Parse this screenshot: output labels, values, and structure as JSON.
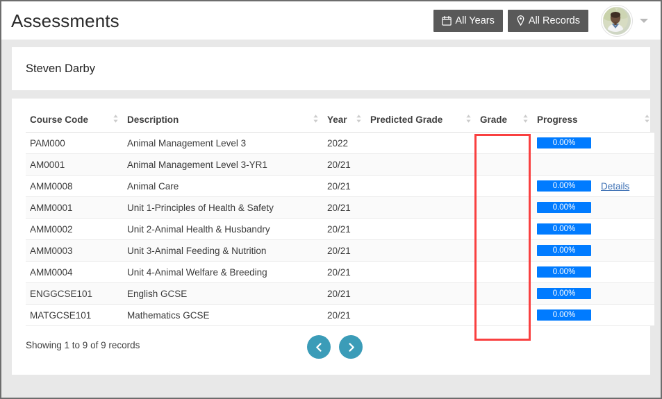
{
  "header": {
    "title": "Assessments",
    "buttons": [
      {
        "label": "All Years",
        "icon": "calendar-icon"
      },
      {
        "label": "All Records",
        "icon": "pin-icon"
      }
    ],
    "avatar_icon": "user-avatar",
    "caret_icon": "chevron-down-icon"
  },
  "student": {
    "name": "Steven Darby"
  },
  "table": {
    "columns": [
      {
        "key": "code",
        "label": "Course Code",
        "sortable": true
      },
      {
        "key": "desc",
        "label": "Description",
        "sortable": true
      },
      {
        "key": "year",
        "label": "Year",
        "sortable": true
      },
      {
        "key": "pred",
        "label": "Predicted Grade",
        "sortable": true
      },
      {
        "key": "grade",
        "label": "Grade",
        "sortable": true
      },
      {
        "key": "progress",
        "label": "Progress",
        "sortable": true
      }
    ],
    "sort_icon": "sort-updown-icon",
    "rows": [
      {
        "code": "PAM000",
        "indent": 0,
        "desc": "Animal Management Level 3",
        "year": "2022",
        "pred": "",
        "grade": "",
        "progress": "0.00%",
        "has_progress": true,
        "details": ""
      },
      {
        "code": "AM0001",
        "indent": 1,
        "desc": "Animal Management Level 3-YR1",
        "year": "20/21",
        "pred": "",
        "grade": "",
        "progress": "",
        "has_progress": false,
        "details": ""
      },
      {
        "code": "AMM0008",
        "indent": 2,
        "desc": "Animal Care",
        "year": "20/21",
        "pred": "",
        "grade": "",
        "progress": "0.00%",
        "has_progress": true,
        "details": "Details"
      },
      {
        "code": "AMM0001",
        "indent": 2,
        "desc": "Unit 1-Principles of Health & Safety",
        "year": "20/21",
        "pred": "",
        "grade": "",
        "progress": "0.00%",
        "has_progress": true,
        "details": ""
      },
      {
        "code": "AMM0002",
        "indent": 2,
        "desc": "Unit 2-Animal Health & Husbandry",
        "year": "20/21",
        "pred": "",
        "grade": "",
        "progress": "0.00%",
        "has_progress": true,
        "details": ""
      },
      {
        "code": "AMM0003",
        "indent": 2,
        "desc": "Unit 3-Animal Feeding & Nutrition",
        "year": "20/21",
        "pred": "",
        "grade": "",
        "progress": "0.00%",
        "has_progress": true,
        "details": ""
      },
      {
        "code": "AMM0004",
        "indent": 2,
        "desc": "Unit 4-Animal Welfare & Breeding",
        "year": "20/21",
        "pred": "",
        "grade": "",
        "progress": "0.00%",
        "has_progress": true,
        "details": ""
      },
      {
        "code": "ENGGCSE101",
        "indent": 0,
        "desc": "English GCSE",
        "year": "20/21",
        "pred": "",
        "grade": "",
        "progress": "0.00%",
        "has_progress": true,
        "details": ""
      },
      {
        "code": "MATGCSE101",
        "indent": 0,
        "desc": "Mathematics GCSE",
        "year": "20/21",
        "pred": "",
        "grade": "",
        "progress": "0.00%",
        "has_progress": true,
        "details": ""
      }
    ]
  },
  "footer": {
    "showing_text": "Showing 1 to 9 of 9 records",
    "prev_icon": "chevron-left-icon",
    "next_icon": "chevron-right-icon"
  },
  "annotation": {
    "highlight_target": "Grade",
    "highlight_color": "#f94040"
  },
  "colors": {
    "progress_bar": "#007bff",
    "pager": "#3b9cb8",
    "filter_button": "#595959",
    "link": "#3f72b5"
  }
}
